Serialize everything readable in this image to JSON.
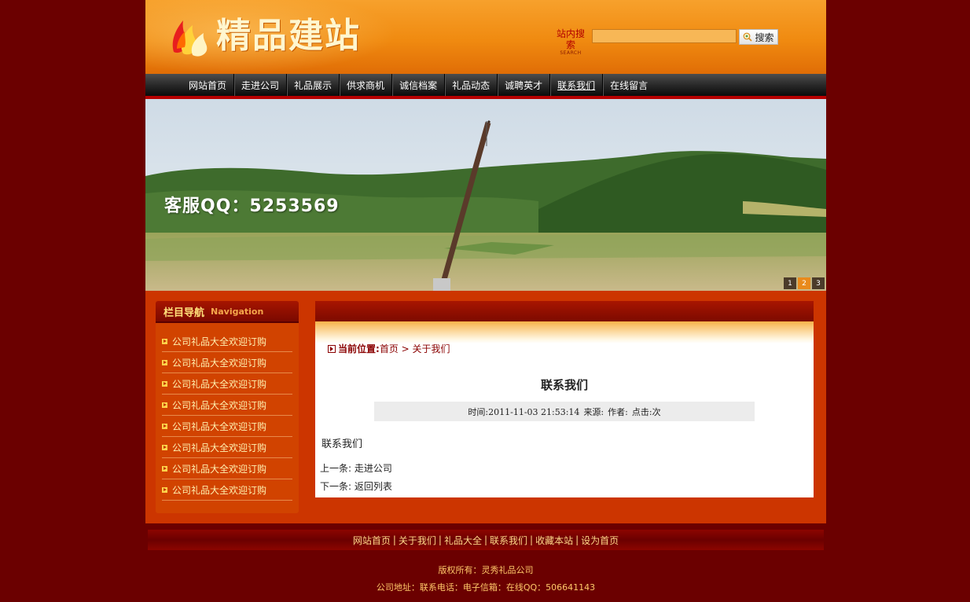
{
  "header": {
    "logo_text": "精品建站",
    "search_label": "站内搜索",
    "search_label_en": "SEARCH",
    "search_value": "",
    "search_button": "搜索"
  },
  "nav": {
    "items": [
      {
        "label": "网站首页"
      },
      {
        "label": "走进公司"
      },
      {
        "label": "礼品展示"
      },
      {
        "label": "供求商机"
      },
      {
        "label": "诚信档案"
      },
      {
        "label": "礼品动态"
      },
      {
        "label": "诚聘英才"
      },
      {
        "label": "联系我们",
        "active": true
      },
      {
        "label": "在线留言"
      }
    ]
  },
  "banner": {
    "caption": "客服QQ：5253569",
    "pages": [
      "1",
      "2",
      "3"
    ],
    "active_page": "2"
  },
  "sidebar": {
    "title": "栏目导航",
    "title_en": "Navigation",
    "items": [
      "公司礼品大全欢迎订购",
      "公司礼品大全欢迎订购",
      "公司礼品大全欢迎订购",
      "公司礼品大全欢迎订购",
      "公司礼品大全欢迎订购",
      "公司礼品大全欢迎订购",
      "公司礼品大全欢迎订购",
      "公司礼品大全欢迎订购"
    ]
  },
  "article": {
    "breadcrumb_label": "当前位置:",
    "breadcrumb_path": "首页 > 关于我们",
    "title": "联系我们",
    "meta_time_label": "时间:",
    "meta_time": "2011-11-03 21:53:14",
    "meta_source_label": "来源:",
    "meta_author_label": "作者:",
    "meta_clicks_label": "点击:",
    "meta_clicks_unit": "次",
    "body": "联系我们",
    "prev_label": "上一条:",
    "prev_link": "走进公司",
    "next_label": "下一条:",
    "next_link": "返回列表"
  },
  "footer": {
    "links": [
      "网站首页",
      "关于我们",
      "礼品大全",
      "联系我们",
      "收藏本站",
      "设为首页"
    ],
    "copyright": "版权所有：灵秀礼品公司",
    "contact": "公司地址：联系电话：电子信箱：在线QQ：506641143"
  },
  "colors": {
    "page_bg": "#6b0000",
    "header_orange": "#f08a10",
    "content_red": "#cc3500",
    "nav_dark": "#262626",
    "accent_gold": "#ffd98a"
  }
}
